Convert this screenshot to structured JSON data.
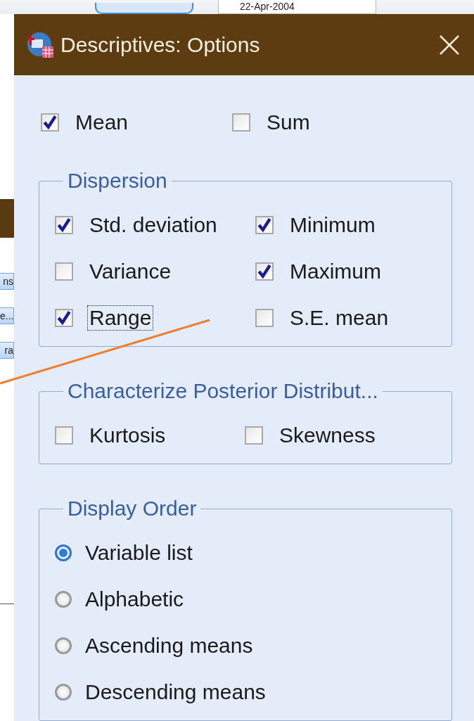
{
  "background_window": {
    "date_field": "22-Apr-2004",
    "buttons": [
      "ns",
      "e...",
      "ra"
    ]
  },
  "dialog": {
    "title": "Descriptives: Options",
    "top_options": [
      {
        "label": "Mean",
        "checked": true
      },
      {
        "label": "Sum",
        "checked": false
      }
    ],
    "groups": [
      {
        "title": "Dispersion",
        "kind": "checkboxes",
        "items": [
          {
            "label": "Std. deviation",
            "checked": true,
            "focused": false
          },
          {
            "label": "Minimum",
            "checked": true,
            "focused": false
          },
          {
            "label": "Variance",
            "checked": false,
            "focused": false
          },
          {
            "label": "Maximum",
            "checked": true,
            "focused": false
          },
          {
            "label": "Range",
            "checked": true,
            "focused": true
          },
          {
            "label": "S.E. mean",
            "checked": false,
            "focused": false
          }
        ]
      },
      {
        "title": "Characterize Posterior Distribut...",
        "kind": "checkboxes",
        "items": [
          {
            "label": "Kurtosis",
            "checked": false,
            "focused": false
          },
          {
            "label": "Skewness",
            "checked": false,
            "focused": false
          }
        ]
      },
      {
        "title": "Display Order",
        "kind": "radios",
        "items": [
          {
            "label": "Variable list",
            "selected": true
          },
          {
            "label": "Alphabetic",
            "selected": false
          },
          {
            "label": "Ascending means",
            "selected": false
          },
          {
            "label": "Descending means",
            "selected": false
          }
        ]
      }
    ]
  }
}
